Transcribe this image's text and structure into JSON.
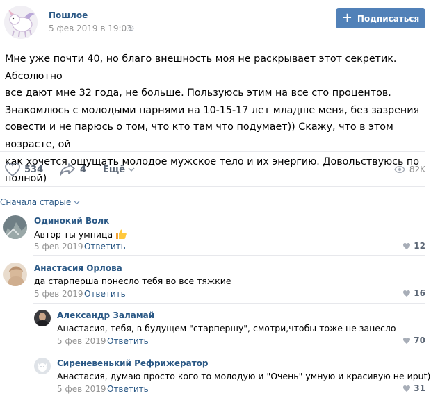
{
  "post": {
    "group_name": "Пошлое",
    "date": "5 фев 2019 в 19:03",
    "subscribe_label": "Подписаться",
    "text_lines": [
      "Мне уже почти 40, но благо внешность моя не раскрывает этот секретик. Абсолютно",
      "все дают мне 32 года, не больше. Пользуюсь этим на все сто процентов.",
      "Знакомлюсь с молодыми парнями на 10-15-17 лет младше меня, без зазрения",
      "совести и не парюсь о том, что кто там что подумает)) Скажу, что в этом возрасте, ой",
      "как хочется ощущать молодое мужское тело и их энергию. Довольствуюсь по",
      "полной)"
    ],
    "likes": "534",
    "shares": "4",
    "more_label": "Ещё",
    "views": "82K"
  },
  "comments_sort": "Сначала старые",
  "comments": [
    {
      "author": "Одинокий Волк",
      "text": "Автор ты умница",
      "date": "5 фев 2019",
      "reply": "Ответить",
      "likes": "12"
    },
    {
      "author": "Анастасия Орлова",
      "text": "да старперша понесло тебя во все тяжкие",
      "date": "5 фев 2019",
      "reply": "Ответить",
      "likes": "16"
    },
    {
      "author": "Александр Заламай",
      "text": "Анастасия, тебя, в будущем \"старпершу\", смотри,чтобы тоже не занесло",
      "date": "5 фев 2019",
      "reply": "Ответить",
      "likes": "70"
    },
    {
      "author": "Сиреневенький Рефрижератор",
      "text": "Анастасия, думаю просто кого то молодую и \"Очень\" умную и красивую не иput))))",
      "date": "5 фев 2019",
      "reply": "Ответить",
      "likes": "31"
    }
  ]
}
